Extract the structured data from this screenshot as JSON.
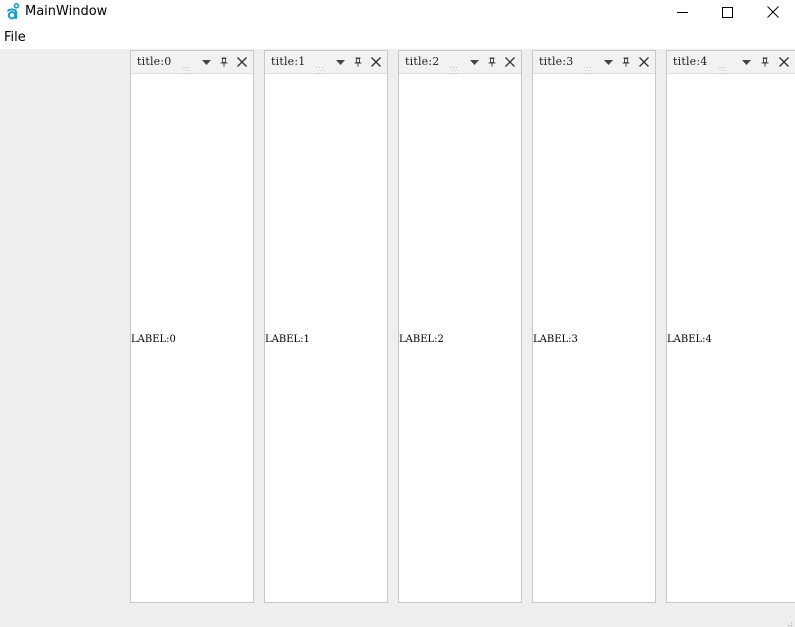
{
  "window": {
    "title": "MainWindow"
  },
  "menubar": {
    "items": [
      {
        "label": "File"
      }
    ]
  },
  "docks": [
    {
      "title": "title:0",
      "label": "LABEL:0"
    },
    {
      "title": "title:1",
      "label": "LABEL:1"
    },
    {
      "title": "title:2",
      "label": "LABEL:2"
    },
    {
      "title": "title:3",
      "label": "LABEL:3"
    },
    {
      "title": "title:4",
      "label": "LABEL:4"
    }
  ],
  "icons": {
    "app": "app-logo-icon",
    "minimize": "minimize-icon",
    "maximize": "maximize-icon",
    "close": "close-icon",
    "dock_menu": "chevron-down-icon",
    "dock_pin": "pin-icon",
    "dock_close": "close-icon",
    "grip": "drag-grip-icon",
    "size_grip": "resize-grip-icon"
  },
  "colors": {
    "accent": "#1a9ebf",
    "central_background": "#eeeef0",
    "dock_header": "#f2f2f4",
    "dock_border": "#c8c8c8"
  }
}
